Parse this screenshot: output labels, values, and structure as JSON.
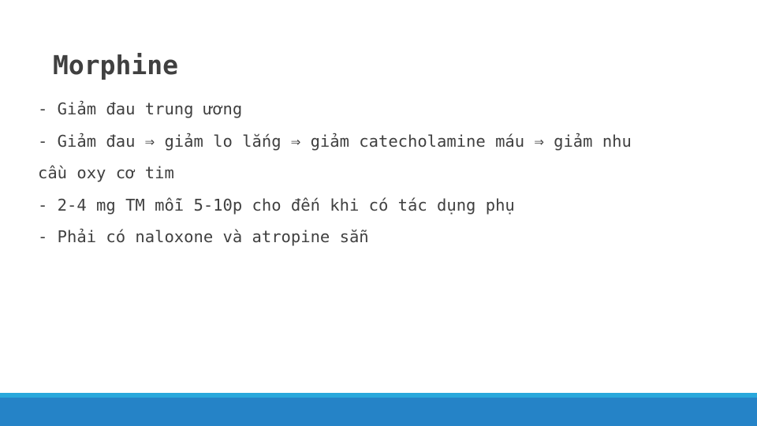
{
  "slide": {
    "title": "Morphine",
    "lines": [
      "- Giảm đau trung ương",
      "- Giảm đau ⇒ giảm lo lắng ⇒ giảm catecholamine máu ⇒ giảm nhu",
      "cầu oxy cơ tim",
      "- 2-4 mg TM mỗi 5-10p cho đến khi có tác dụng phụ",
      "- Phải có naloxone và atropine sẵn"
    ]
  },
  "colors": {
    "text": "#404040",
    "bar_top": "#29a8dc",
    "bar_bottom": "#2583c7"
  }
}
